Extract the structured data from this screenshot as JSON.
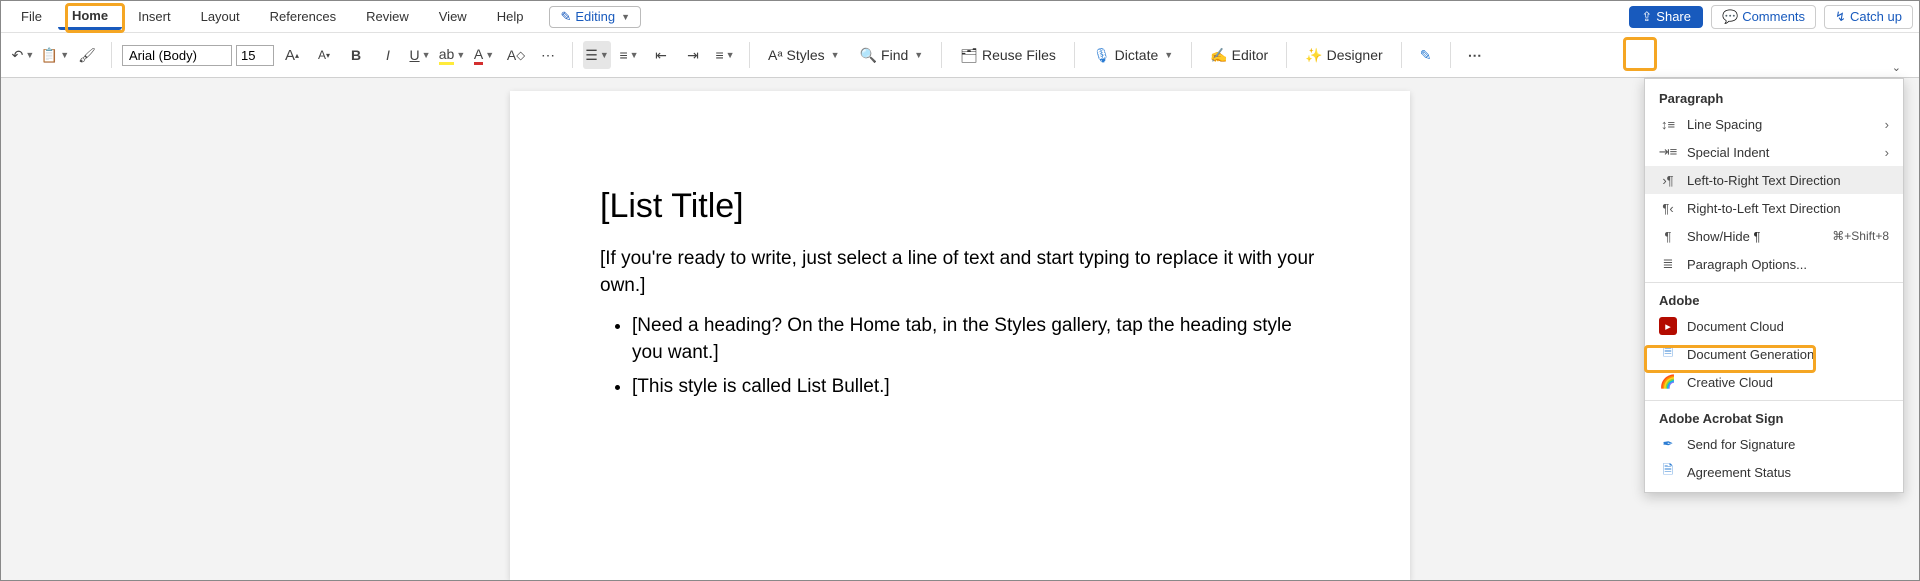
{
  "tabs": {
    "file": "File",
    "home": "Home",
    "insert": "Insert",
    "layout": "Layout",
    "references": "References",
    "review": "Review",
    "view": "View",
    "help": "Help"
  },
  "editing": {
    "label": "Editing"
  },
  "actions": {
    "share": "Share",
    "comments": "Comments",
    "catchup": "Catch up"
  },
  "ribbon": {
    "font": "Arial (Body)",
    "size": "15",
    "styles": "Styles",
    "find": "Find",
    "reuse": "Reuse Files",
    "dictate": "Dictate",
    "editor": "Editor",
    "designer": "Designer"
  },
  "document": {
    "title": "[List Title]",
    "para": "[If you're ready to write, just select a line of text and start typing to replace it with your own.]",
    "bullets": [
      "[Need a heading? On the Home tab, in the Styles gallery, tap the heading style you want.]",
      "[This style is called List Bullet.]"
    ]
  },
  "menu": {
    "paragraph_h": "Paragraph",
    "line_spacing": "Line Spacing",
    "special_indent": "Special Indent",
    "ltr": "Left-to-Right Text Direction",
    "rtl": "Right-to-Left Text Direction",
    "showhide": "Show/Hide ¶",
    "showhide_sc": "⌘+Shift+8",
    "para_opts": "Paragraph Options...",
    "adobe_h": "Adobe",
    "doc_cloud": "Document Cloud",
    "doc_gen": "Document Generation",
    "creative": "Creative Cloud",
    "sign_h": "Adobe Acrobat Sign",
    "send_sig": "Send for Signature",
    "agree": "Agreement Status"
  }
}
